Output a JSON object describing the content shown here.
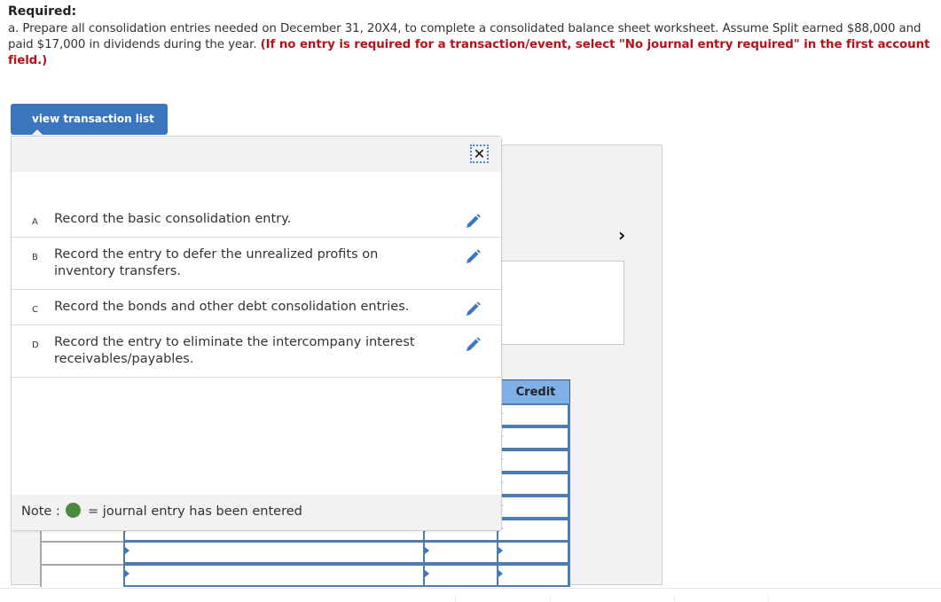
{
  "instructions": {
    "heading": "Required:",
    "body": "a. Prepare all consolidation entries needed on December 31, 20X4, to complete a consolidated balance sheet worksheet. Assume Split earned $88,000 and paid $17,000 in dividends during the year. ",
    "emphasis": "(If no entry is required for a transaction/event, select \"No journal entry required\" in the first account field.)"
  },
  "toolbar": {
    "view_transaction_list_label": "view transaction list"
  },
  "transaction_popup": {
    "close_icon": "close-icon",
    "items": [
      {
        "letter": "A",
        "label": "Record the basic consolidation entry.",
        "icon": "pencil-icon"
      },
      {
        "letter": "B",
        "label": "Record the entry to defer the unrealized profits on inventory transfers.",
        "icon": "pencil-icon"
      },
      {
        "letter": "C",
        "label": "Record the bonds and other debt consolidation entries.",
        "icon": "pencil-icon"
      },
      {
        "letter": "D",
        "label": "Record the entry to eliminate the intercompany interest receivables/payables.",
        "icon": "pencil-icon"
      }
    ],
    "note_prefix": "Note : ",
    "note_suffix": " = journal entry has been entered",
    "note_dot_color": "#4c8a3e"
  },
  "worksheet": {
    "next_icon": "chevron-right-icon",
    "credit_header": "Credit",
    "accent_color": "#4f7bb3"
  }
}
